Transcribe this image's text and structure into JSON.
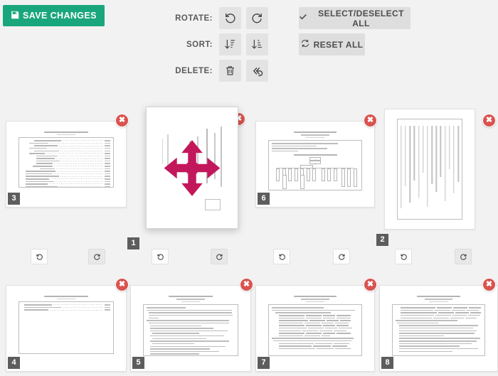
{
  "toolbar": {
    "save_label": "SAVE CHANGES",
    "save_icon": "floppy-disk-icon",
    "save_color": "#1aa67c",
    "rows": [
      {
        "label": "ROTATE:",
        "buttons": [
          {
            "name": "rotate-all-left-button",
            "icon": "rotate-left-icon"
          },
          {
            "name": "rotate-all-right-button",
            "icon": "rotate-right-icon"
          }
        ]
      },
      {
        "label": "SORT:",
        "buttons": [
          {
            "name": "sort-ascending-button",
            "icon": "sort-amount-asc-icon"
          },
          {
            "name": "sort-descending-button",
            "icon": "sort-amount-desc-icon"
          }
        ]
      },
      {
        "label": "DELETE:",
        "buttons": [
          {
            "name": "delete-selected-button",
            "icon": "trash-icon"
          },
          {
            "name": "undo-delete-button",
            "icon": "undo-double-arrow-icon"
          }
        ]
      }
    ],
    "select_all_label": "SELECT/DESELECT ALL",
    "select_all_icon": "check-icon",
    "reset_all_label": "RESET ALL",
    "reset_all_icon": "refresh-icon"
  },
  "thumbnails": {
    "delete_icon": "close-x-icon",
    "delete_color": "#d9534f",
    "badge_color": "#5d5d5d",
    "rotate_left_icon": "rotate-left-icon",
    "rotate_right_icon": "rotate-right-icon",
    "items": [
      {
        "page": "3",
        "kind": "toc"
      },
      {
        "page": "1",
        "kind": "cover",
        "state": "dragging",
        "overlay_icon": "move-arrows-icon",
        "overlay_color": "#c2185b"
      },
      {
        "page": "6",
        "kind": "orgchart"
      },
      {
        "page": "2",
        "kind": "table-portrait",
        "rotated": true
      },
      {
        "page": "4",
        "kind": "short-toc"
      },
      {
        "page": "5",
        "kind": "dense-text"
      },
      {
        "page": "7",
        "kind": "list-table"
      },
      {
        "page": "8",
        "kind": "mixed-text"
      }
    ]
  },
  "page_rotate_buttons": [
    {
      "page": "3",
      "left": "rotate-left-icon",
      "right": "rotate-right-icon"
    },
    {
      "page": "1",
      "left": "rotate-left-icon",
      "right": "rotate-right-icon"
    },
    {
      "page": "6",
      "left": "rotate-left-icon",
      "right": "rotate-right-icon"
    },
    {
      "page": "2",
      "left": "rotate-left-icon",
      "right": "rotate-right-icon"
    }
  ],
  "colors": {
    "background": "#f2f2f2",
    "toolbar_button": "#e3e3e3",
    "wide_button": "#dedede",
    "paper": "#ffffff"
  }
}
